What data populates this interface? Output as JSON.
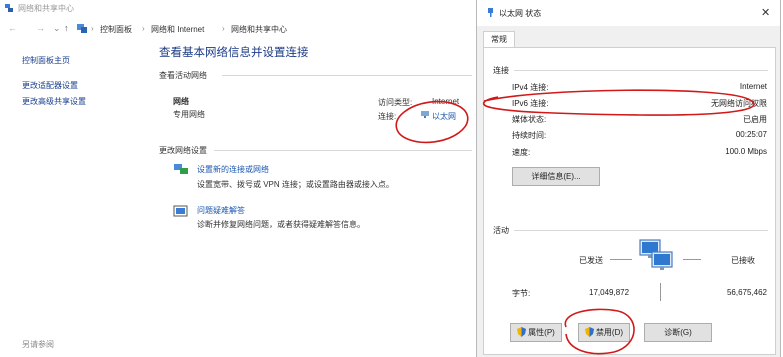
{
  "background_window": {
    "title": "网络和共享中心",
    "breadcrumb": [
      "控制面板",
      "网络和 Internet",
      "网络和共享中心"
    ],
    "sidebar": {
      "items": [
        "控制面板主页",
        "更改适配器设置",
        "更改高级共享设置"
      ],
      "see_also": "另请参阅"
    },
    "main": {
      "heading": "查看基本网络信息并设置连接",
      "active_networks_title": "查看活动网络",
      "network_name": "网络",
      "network_type": "专用网络",
      "access_type_label": "访问类型:",
      "access_type_value": "Internet",
      "connections_label": "连接:",
      "connections_value": "以太网",
      "change_settings_title": "更改网络设置",
      "tasks": [
        {
          "title": "设置新的连接或网络",
          "desc": "设置宽带、拨号或 VPN 连接；或设置路由器或接入点。"
        },
        {
          "title": "问题疑难解答",
          "desc": "诊断并修复网络问题，或者获得疑难解答信息。"
        }
      ]
    }
  },
  "dialog": {
    "title": "以太网 状态",
    "close_glyph": "✕",
    "tab": "常规",
    "connection": {
      "group_label": "连接",
      "rows": [
        {
          "label": "IPv4 连接:",
          "value": "Internet"
        },
        {
          "label": "IPv6 连接:",
          "value": "无网络访问权限"
        },
        {
          "label": "媒体状态:",
          "value": "已启用"
        },
        {
          "label": "持续时间:",
          "value": "00:25:07"
        },
        {
          "label": "速度:",
          "value": "100.0 Mbps"
        }
      ],
      "details_button": "详细信息(E)..."
    },
    "activity": {
      "group_label": "活动",
      "sent_label": "已发送",
      "received_label": "已接收",
      "bytes_label": "字节:",
      "bytes_sent": "17,049,872",
      "bytes_received": "56,675,462"
    },
    "buttons": {
      "properties": "属性(P)",
      "disable": "禁用(D)",
      "diagnose": "诊断(G)"
    }
  },
  "colors": {
    "link_blue": "#1a57b0",
    "heading_blue": "#1c3c86",
    "annotation_red": "#d11919",
    "dialog_bg": "#f0f0f0"
  }
}
